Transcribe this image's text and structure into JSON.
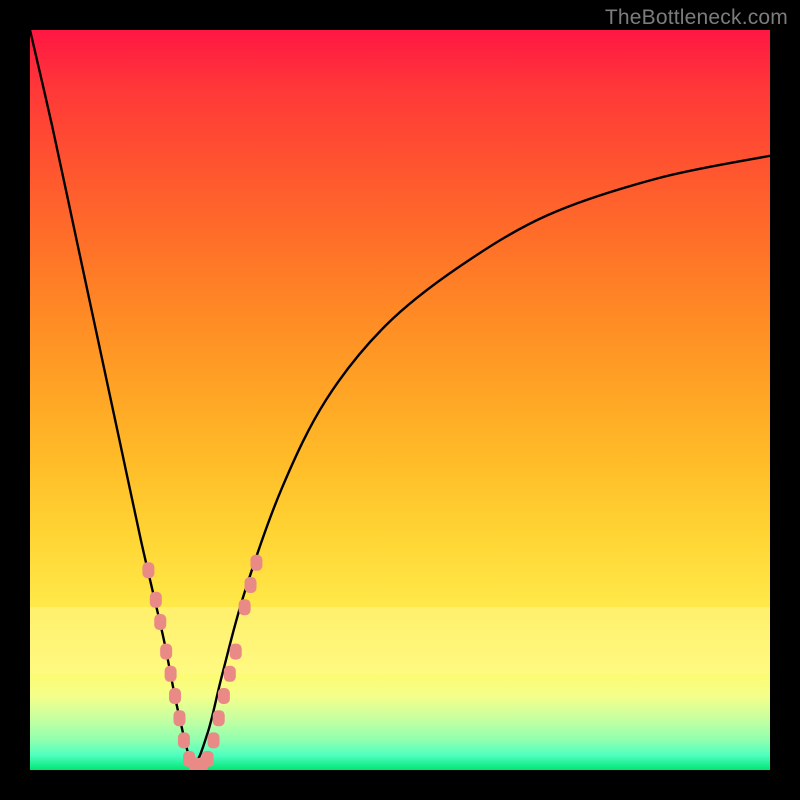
{
  "watermark": "TheBottleneck.com",
  "chart_data": {
    "type": "line",
    "title": "",
    "xlabel": "",
    "ylabel": "",
    "xlim": [
      0,
      100
    ],
    "ylim": [
      0,
      100
    ],
    "grid": false,
    "legend": false,
    "description": "Bottleneck percentage curve. Vertical axis = bottleneck % (0 at bottom, 100 at top). Horizontal axis = relative component balance. Minimum near x≈22. Background gradient red→yellow→green encodes severity (red high bottleneck, green none).",
    "series": [
      {
        "name": "bottleneck-curve",
        "x": [
          0,
          3,
          6,
          9,
          12,
          15,
          18,
          20,
          22,
          24,
          26,
          29,
          34,
          40,
          48,
          58,
          70,
          85,
          100
        ],
        "y": [
          100,
          87,
          73,
          59,
          45,
          31,
          18,
          8,
          1,
          5,
          13,
          24,
          38,
          50,
          60,
          68,
          75,
          80,
          83
        ]
      }
    ],
    "markers": [
      {
        "name": "recommended-dots",
        "shape": "rounded",
        "color": "#e98a86",
        "points": [
          {
            "x": 16.0,
            "y": 27
          },
          {
            "x": 17.0,
            "y": 23
          },
          {
            "x": 17.6,
            "y": 20
          },
          {
            "x": 18.4,
            "y": 16
          },
          {
            "x": 19.0,
            "y": 13
          },
          {
            "x": 19.6,
            "y": 10
          },
          {
            "x": 20.2,
            "y": 7
          },
          {
            "x": 20.8,
            "y": 4
          },
          {
            "x": 21.5,
            "y": 1.5
          },
          {
            "x": 22.3,
            "y": 0.6
          },
          {
            "x": 23.2,
            "y": 0.6
          },
          {
            "x": 24.0,
            "y": 1.5
          },
          {
            "x": 24.8,
            "y": 4
          },
          {
            "x": 25.5,
            "y": 7
          },
          {
            "x": 26.2,
            "y": 10
          },
          {
            "x": 27.0,
            "y": 13
          },
          {
            "x": 27.8,
            "y": 16
          },
          {
            "x": 29.0,
            "y": 22
          },
          {
            "x": 29.8,
            "y": 25
          },
          {
            "x": 30.6,
            "y": 28
          }
        ]
      }
    ],
    "gradient_stops": [
      {
        "pct": 0,
        "color": "#ff1744"
      },
      {
        "pct": 50,
        "color": "#ffa225"
      },
      {
        "pct": 85,
        "color": "#fff96b"
      },
      {
        "pct": 100,
        "color": "#00e676"
      }
    ]
  }
}
